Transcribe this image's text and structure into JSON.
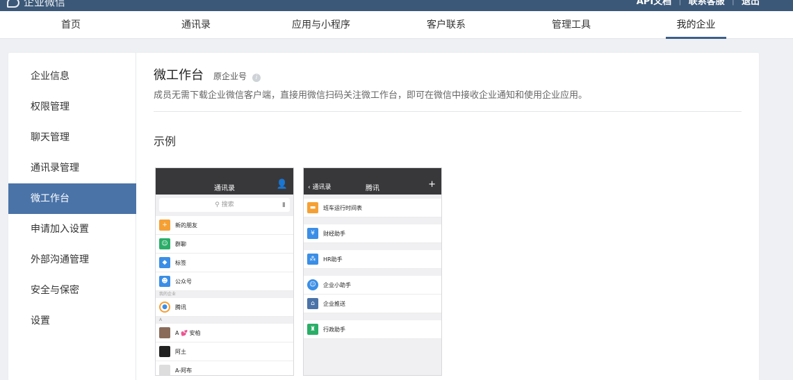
{
  "app": {
    "title": "企业微信"
  },
  "top_links": [
    "API文档",
    "联系客服",
    "退出"
  ],
  "nav": {
    "tabs": [
      "首页",
      "通讯录",
      "应用与小程序",
      "客户联系",
      "管理工具",
      "我的企业"
    ],
    "active_tab": "我的企业"
  },
  "sidebar": {
    "items": [
      "企业信息",
      "权限管理",
      "聊天管理",
      "通讯录管理",
      "微工作台",
      "申请加入设置",
      "外部沟通管理",
      "安全与保密",
      "设置"
    ],
    "active_item": "微工作台"
  },
  "main": {
    "title": "微工作台",
    "subtitle": "原企业号",
    "description": "成员无需下载企业微信客户端，直接用微信扫码关注微工作台，即可在微信中接收企业通知和使用企业应用。",
    "section_title": "示例"
  },
  "phone1": {
    "title": "通讯录",
    "search_placeholder": "搜索",
    "rows": [
      "新的朋友",
      "群聊",
      "标签",
      "公众号"
    ],
    "group_label": "我的企业",
    "company": "腾讯",
    "letter_label": "A",
    "contacts": [
      "A 💕 安柏",
      "阿土",
      "A-阿布"
    ]
  },
  "phone2": {
    "back_label": "通讯录",
    "title": "腾讯",
    "items": [
      "班车运行时间表",
      "财经助手",
      "HR助手",
      "企业小助手",
      "企业推送",
      "行政助手"
    ],
    "item_icons": [
      "bus-icon",
      "finance-icon",
      "hr-icon",
      "assistant-icon",
      "home-icon",
      "admin-icon"
    ]
  },
  "colors": {
    "topbar": "#3c5878",
    "active_nav_underline": "#3c5e88",
    "sidebar_active_bg": "#4a73a8",
    "phone_header": "#38383b",
    "orange": "#f5a034",
    "green": "#2aae67",
    "blue": "#3a8ee6"
  }
}
